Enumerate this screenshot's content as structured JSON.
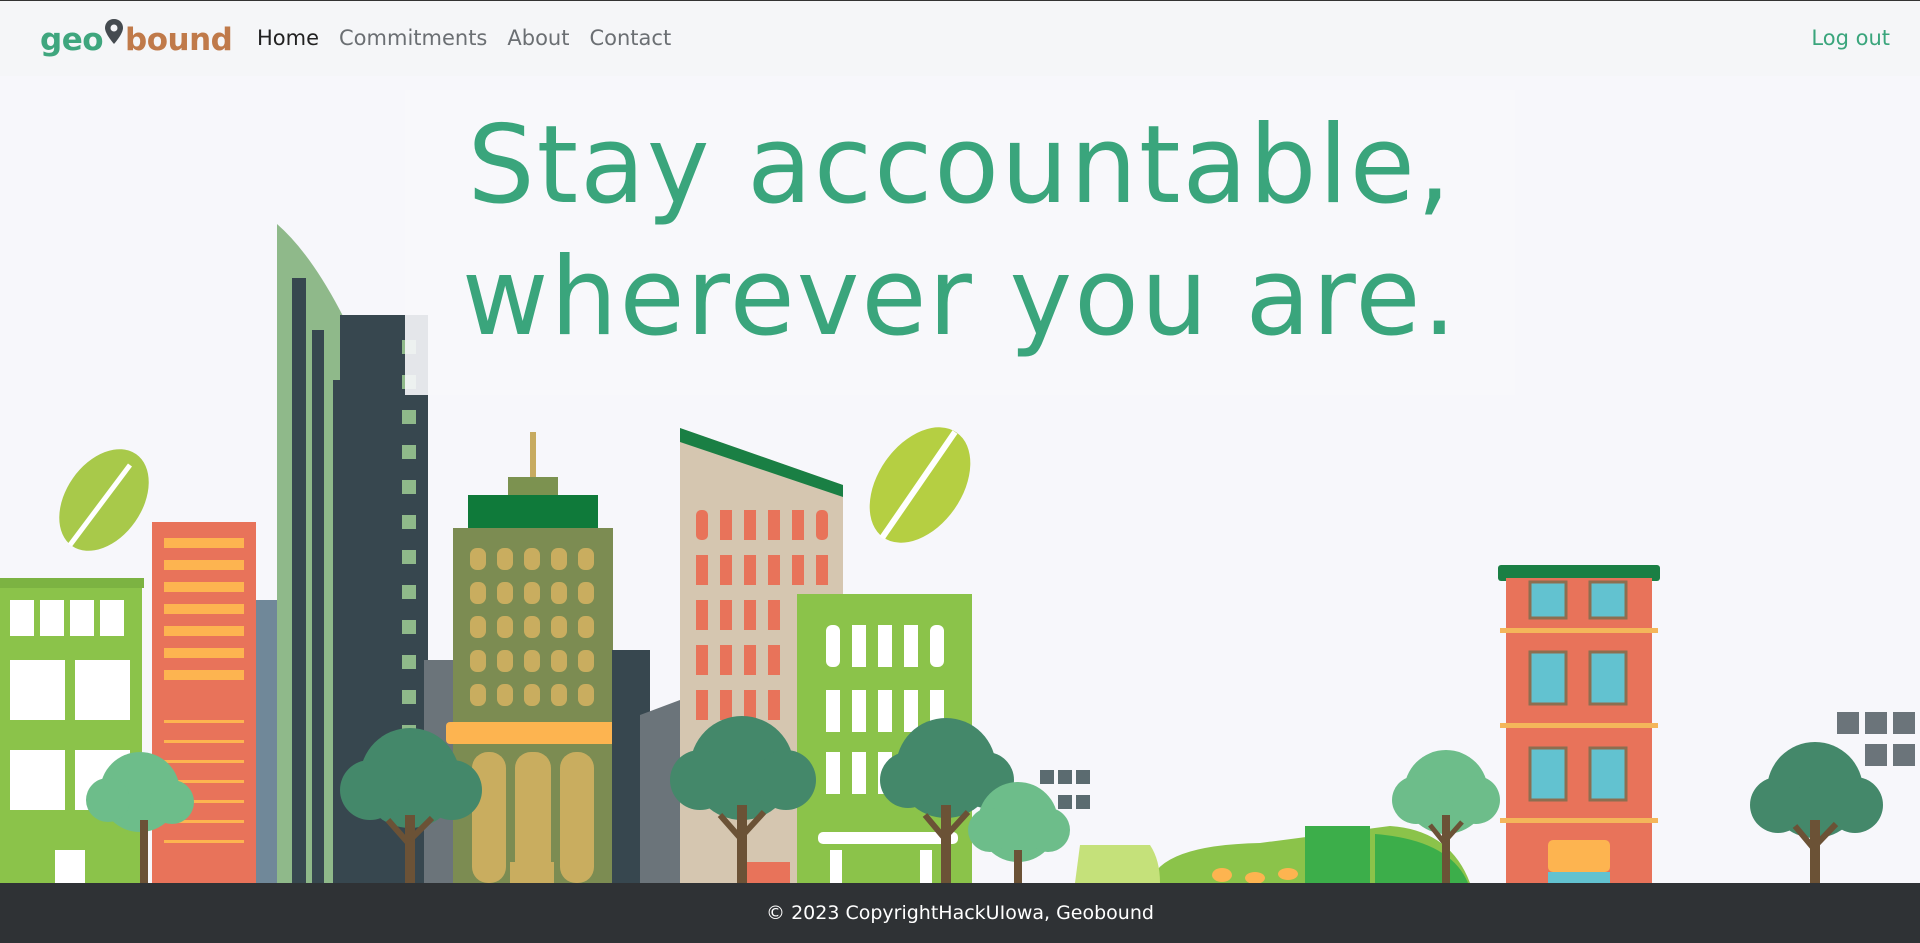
{
  "brand": {
    "part1": "geo",
    "part2": "bound",
    "colors": {
      "geo": "#3fa67e",
      "bound": "#c07a4a",
      "pin": "#454b50"
    }
  },
  "nav": {
    "items": [
      {
        "label": "Home",
        "active": true
      },
      {
        "label": "Commitments",
        "active": false
      },
      {
        "label": "About",
        "active": false
      },
      {
        "label": "Contact",
        "active": false
      }
    ],
    "logout_label": "Log out"
  },
  "hero": {
    "line1": "Stay accountable,",
    "line2": "wherever you are.",
    "color": "#3aa57c"
  },
  "footer": {
    "text": "© 2023 CopyrightHackUIowa, Geobound"
  },
  "colors": {
    "background": "#f7f7fb",
    "footer_bg": "#2f3235",
    "accent_green": "#3aa57c"
  }
}
